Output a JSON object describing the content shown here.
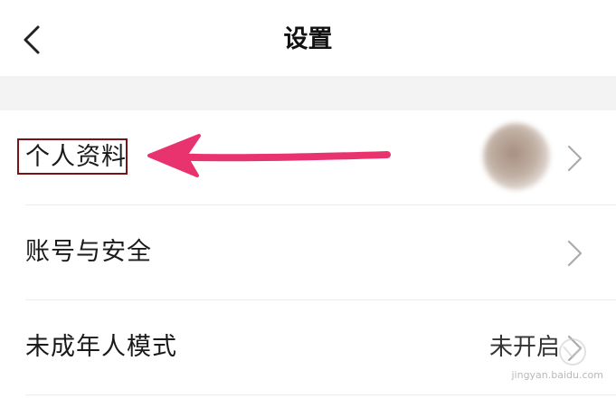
{
  "header": {
    "title": "设置",
    "back_icon": "chevron-left-icon"
  },
  "settings": {
    "items": [
      {
        "label": "个人资料",
        "value": ""
      },
      {
        "label": "账号与安全",
        "value": ""
      },
      {
        "label": "未成年人模式",
        "value": "未开启"
      }
    ]
  },
  "annotation": {
    "arrow_color": "#e8336f",
    "box_color": "#7a1414"
  },
  "watermark": {
    "text": "jingyan.baidu.com"
  }
}
